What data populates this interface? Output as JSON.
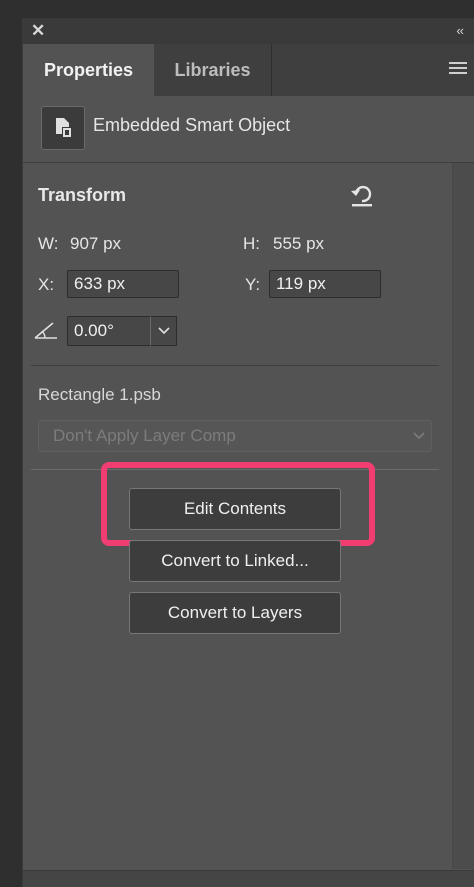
{
  "window": {
    "close_glyph": "✕",
    "collapse_glyph": "‹‹"
  },
  "tabs": [
    {
      "label": "Properties",
      "active": true
    },
    {
      "label": "Libraries",
      "active": false
    }
  ],
  "object": {
    "icon": "smart-object-icon",
    "label": "Embedded Smart Object"
  },
  "transform": {
    "header": "Transform",
    "w_label": "W:",
    "w_value": "907 px",
    "h_label": "H:",
    "h_value": "555 px",
    "x_label": "X:",
    "x_value": "633 px",
    "y_label": "Y:",
    "y_value": "119 px",
    "angle_value": "0.00°"
  },
  "source": {
    "filename": "Rectangle 1.psb",
    "layer_comp_value": "Don't Apply Layer Comp"
  },
  "buttons": {
    "edit_contents": "Edit Contents",
    "convert_linked": "Convert to Linked...",
    "convert_layers": "Convert to Layers"
  },
  "colors": {
    "panel_bg": "#535353",
    "highlight": "#f23d72"
  }
}
